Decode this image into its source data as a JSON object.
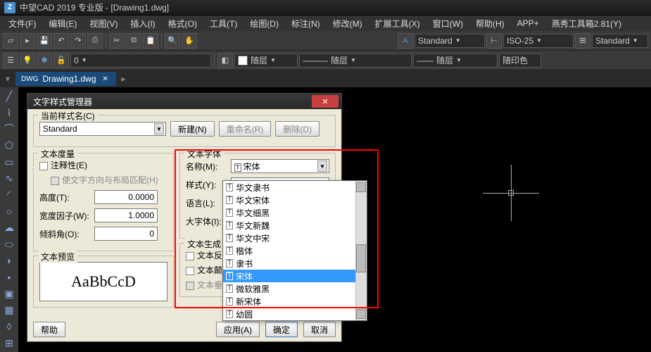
{
  "title": "中望CAD 2019 专业版 - [Drawing1.dwg]",
  "menu": [
    "文件(F)",
    "编辑(E)",
    "视图(V)",
    "插入(I)",
    "格式(O)",
    "工具(T)",
    "绘图(D)",
    "标注(N)",
    "修改(M)",
    "扩展工具(X)",
    "窗口(W)",
    "帮助(H)",
    "APP+",
    "燕秀工具箱2.81(Y)"
  ],
  "tb_combo1": "Standard",
  "tb_combo2": "ISO-25",
  "tb_combo3": "Standard",
  "layer_label": "随层",
  "doc_tab": "Drawing1.dwg",
  "dialog": {
    "title": "文字样式管理器",
    "cur_style_label": "当前样式名(C)",
    "cur_style": "Standard",
    "btn_new": "新建(N)",
    "btn_rename": "重命名(R)",
    "btn_delete": "删除(D)",
    "grp_measure": "文本度量",
    "chk_annotative": "注释性(E)",
    "chk_match": "使文字方向与布局匹配(H)",
    "lbl_height": "高度(T):",
    "val_height": "0.0000",
    "lbl_width": "宽度因子(W):",
    "val_width": "1.0000",
    "lbl_oblique": "倾斜角(O):",
    "val_oblique": "0",
    "grp_font": "文本字体",
    "lbl_name": "名称(M):",
    "val_name": "宋体",
    "lbl_style": "样式(Y):",
    "lbl_lang": "语言(L):",
    "lbl_bigfont": "大字体(I):",
    "grp_gen": "文本生成",
    "chk_backwards": "文本反向",
    "chk_upside": "文本颠倒",
    "chk_vertical": "文本垂直",
    "grp_preview": "文本预览",
    "preview": "AaBbCcD",
    "btn_help": "帮助",
    "btn_apply": "应用(A)",
    "btn_ok": "确定",
    "btn_cancel": "取消"
  },
  "fonts": [
    "华文隶书",
    "华文宋体",
    "华文细黑",
    "华文新魏",
    "华文中宋",
    "楷体",
    "隶书",
    "宋体",
    "微软雅黑",
    "新宋体",
    "幼圆"
  ],
  "font_selected": "宋体"
}
